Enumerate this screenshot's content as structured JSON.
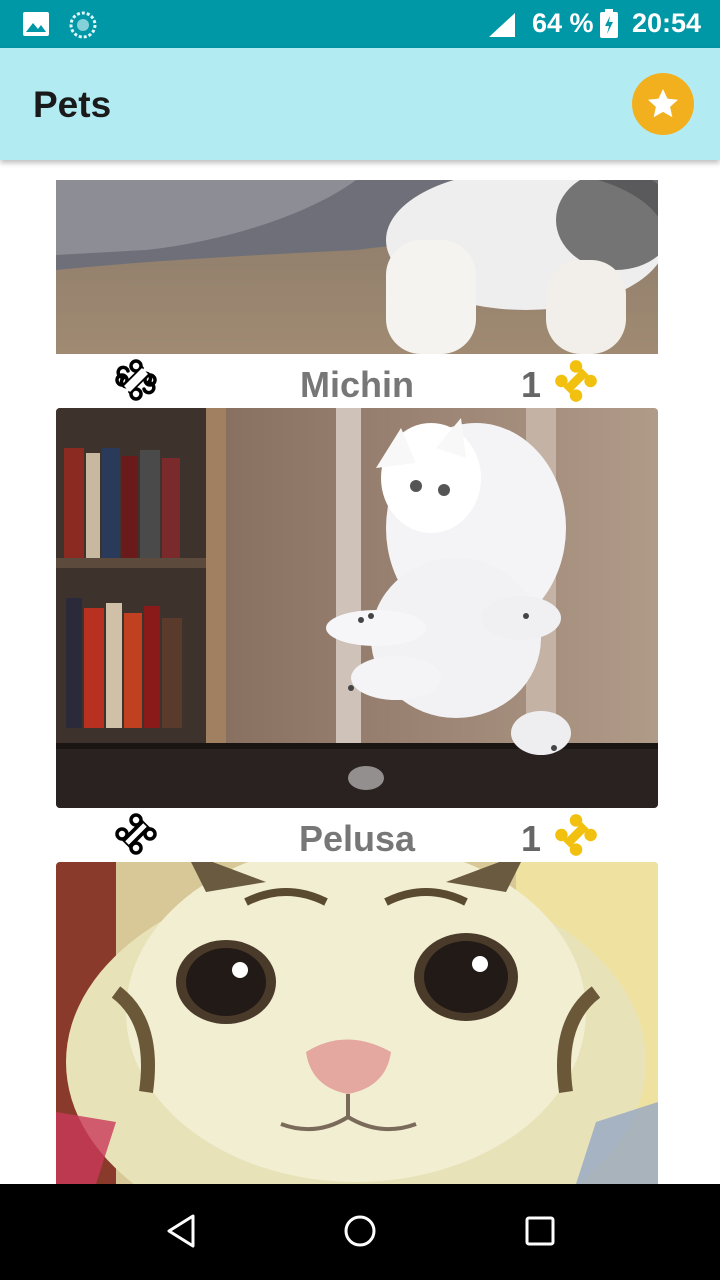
{
  "status_bar": {
    "battery": "64 %",
    "time": "20:54"
  },
  "app_bar": {
    "title": "Pets",
    "favorites_icon": "star-icon"
  },
  "pets": [
    {
      "name": "Michin",
      "rating": "1",
      "rate_icon": "bone-outline-icon",
      "rating_icon": "bone-filled-icon"
    },
    {
      "name": "Pelusa",
      "rating": "1",
      "rate_icon": "bone-outline-icon",
      "rating_icon": "bone-filled-icon"
    }
  ],
  "nav_bar": {
    "back_icon": "back-icon",
    "home_icon": "home-icon",
    "recents_icon": "recents-icon"
  },
  "colors": {
    "status_bar": "#0097a7",
    "app_bar": "#b2ebf2",
    "accent": "#f2b01e",
    "bone_filled": "#f2c00f"
  }
}
